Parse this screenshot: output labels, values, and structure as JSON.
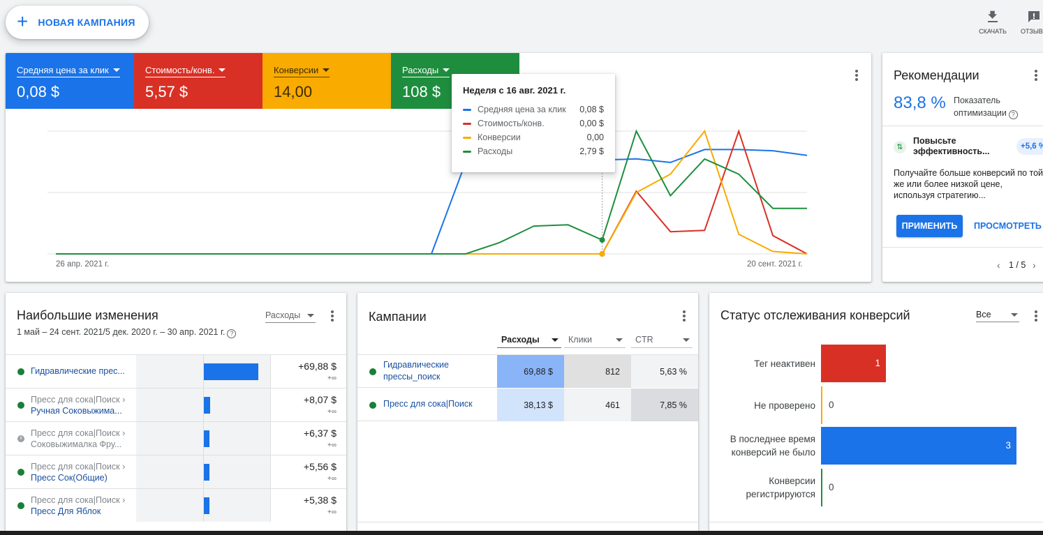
{
  "topbar": {
    "new_campaign": "НОВАЯ КАМПАНИЯ",
    "download": "СКАЧАТЬ",
    "feedback": "ОТЗЫВ"
  },
  "colors": {
    "blue": "#1a73e8",
    "red": "#d93025",
    "yellow": "#f9ab00",
    "green": "#1e8e3e"
  },
  "metrics": [
    {
      "label": "Средняя цена за клик",
      "value": "0,08 $"
    },
    {
      "label": "Стоимость/конв.",
      "value": "5,57 $"
    },
    {
      "label": "Конверсии",
      "value": "14,00"
    },
    {
      "label": "Расходы",
      "value": "108 $"
    }
  ],
  "chart": {
    "x_start": "26 апр. 2021 г.",
    "x_end": "20 сент. 2021 г."
  },
  "chart_data": {
    "type": "line",
    "x": [
      "26 апр. 2021 г.",
      "",
      "",
      "",
      "",
      "",
      "",
      "",
      "",
      "",
      "",
      "",
      "",
      "",
      "",
      "",
      "Неделя с 16 авг. 2021 г.",
      "",
      "",
      "",
      "",
      "",
      "20 сент. 2021 г."
    ],
    "series": [
      {
        "name": "Средняя цена за клик",
        "color": "#1a73e8",
        "values": [
          0,
          0,
          0,
          0,
          0,
          0,
          0,
          0,
          0,
          0,
          0,
          0,
          0.078,
          0.078,
          0.077,
          0.08,
          0.08,
          0.081,
          0.078,
          0.089,
          0.089,
          0.088,
          0.084
        ]
      },
      {
        "name": "Стоимость/конв.",
        "color": "#d93025",
        "values": [
          0,
          0,
          0,
          0,
          0,
          0,
          0,
          0,
          0,
          0,
          0,
          0,
          0,
          0,
          0,
          0,
          0,
          0.48,
          0.17,
          0.18,
          0.94,
          0.14,
          0
        ]
      },
      {
        "name": "Конверсии",
        "color": "#f9ab00",
        "values": [
          0,
          0,
          0,
          0,
          0,
          0,
          0,
          0,
          0,
          0,
          0,
          0,
          0,
          0,
          0,
          0,
          0,
          0.5,
          0.65,
          1,
          0.16,
          0.02,
          0
        ]
      },
      {
        "name": "Расходы",
        "color": "#1e8e3e",
        "values": [
          0,
          0,
          0,
          0,
          0,
          0,
          0,
          0,
          0,
          0,
          0,
          0,
          0,
          0.09,
          0.22,
          0.23,
          0.11,
          0.97,
          0.46,
          0.75,
          0.63,
          0.36,
          0.36
        ]
      }
    ]
  },
  "tooltip": {
    "title": "Неделя с 16 авг. 2021 г.",
    "rows": [
      {
        "name": "Средняя цена за клик",
        "value": "0,08 $"
      },
      {
        "name": "Стоимость/конв.",
        "value": "0,00 $"
      },
      {
        "name": "Конверсии",
        "value": "0,00"
      },
      {
        "name": "Расходы",
        "value": "2,79 $"
      }
    ]
  },
  "recommendations": {
    "title": "Рекомендации",
    "score": "83,8 %",
    "score_label": "Показатель оптимизации",
    "item_title": "Повысьте эффективность...",
    "item_badge": "+5,6 %",
    "item_text": "Получайте больше конверсий по той же или более низкой цене, используя стратегию...",
    "apply": "ПРИМЕНИТЬ",
    "view": "ПРОСМОТРЕТЬ",
    "pager": "1 / 5"
  },
  "changes": {
    "title": "Наибольшие изменения",
    "selector": "Расходы",
    "range": "1 май – 24 сент. 2021/5 дек. 2020 г. – 30 апр. 2021 г.",
    "rows": [
      {
        "parent": "",
        "name": "Гидравлические прес...",
        "value": "+69,88 $",
        "pct": "+∞",
        "bar": 1.0,
        "status": "active"
      },
      {
        "parent": "Пресс для сока|Поиск ›",
        "name": "Ручная Соковыжима...",
        "value": "+8,07 $",
        "pct": "+∞",
        "bar": 0.12,
        "status": "active"
      },
      {
        "parent": "Пресс для сока|Поиск ›",
        "name": "Соковыжималка Фру...",
        "value": "+6,37 $",
        "pct": "+∞",
        "bar": 0.09,
        "status": "paused"
      },
      {
        "parent": "Пресс для сока|Поиск ›",
        "name": "Пресс Сок(Общие)",
        "value": "+5,56 $",
        "pct": "+∞",
        "bar": 0.08,
        "status": "active"
      },
      {
        "parent": "Пресс для сока|Поиск ›",
        "name": "Пресс Для Яблок",
        "value": "+5,38 $",
        "pct": "+∞",
        "bar": 0.08,
        "status": "active"
      }
    ]
  },
  "campaigns": {
    "title": "Кампании",
    "columns": [
      "Расходы",
      "Клики",
      "CTR"
    ],
    "rows": [
      {
        "name": "Гидравлические прессы_поиск",
        "cost": "69,88 $",
        "clicks": "812",
        "ctr": "5,63 %"
      },
      {
        "name": "Пресс для сока|Поиск",
        "cost": "38,13 $",
        "clicks": "461",
        "ctr": "7,85 %"
      }
    ]
  },
  "conversions": {
    "title": "Статус отслеживания конверсий",
    "filter": "Все",
    "bars": [
      {
        "label": "Тег неактивен",
        "value": 1,
        "color": "#d93025"
      },
      {
        "label": "Не проверено",
        "value": 0,
        "color": "#f9ab00"
      },
      {
        "label": "В последнее время конверсий не было",
        "value": 3,
        "color": "#1a73e8"
      },
      {
        "label": "Конверсии регистрируются",
        "value": 0,
        "color": "#1e8e3e"
      }
    ]
  }
}
